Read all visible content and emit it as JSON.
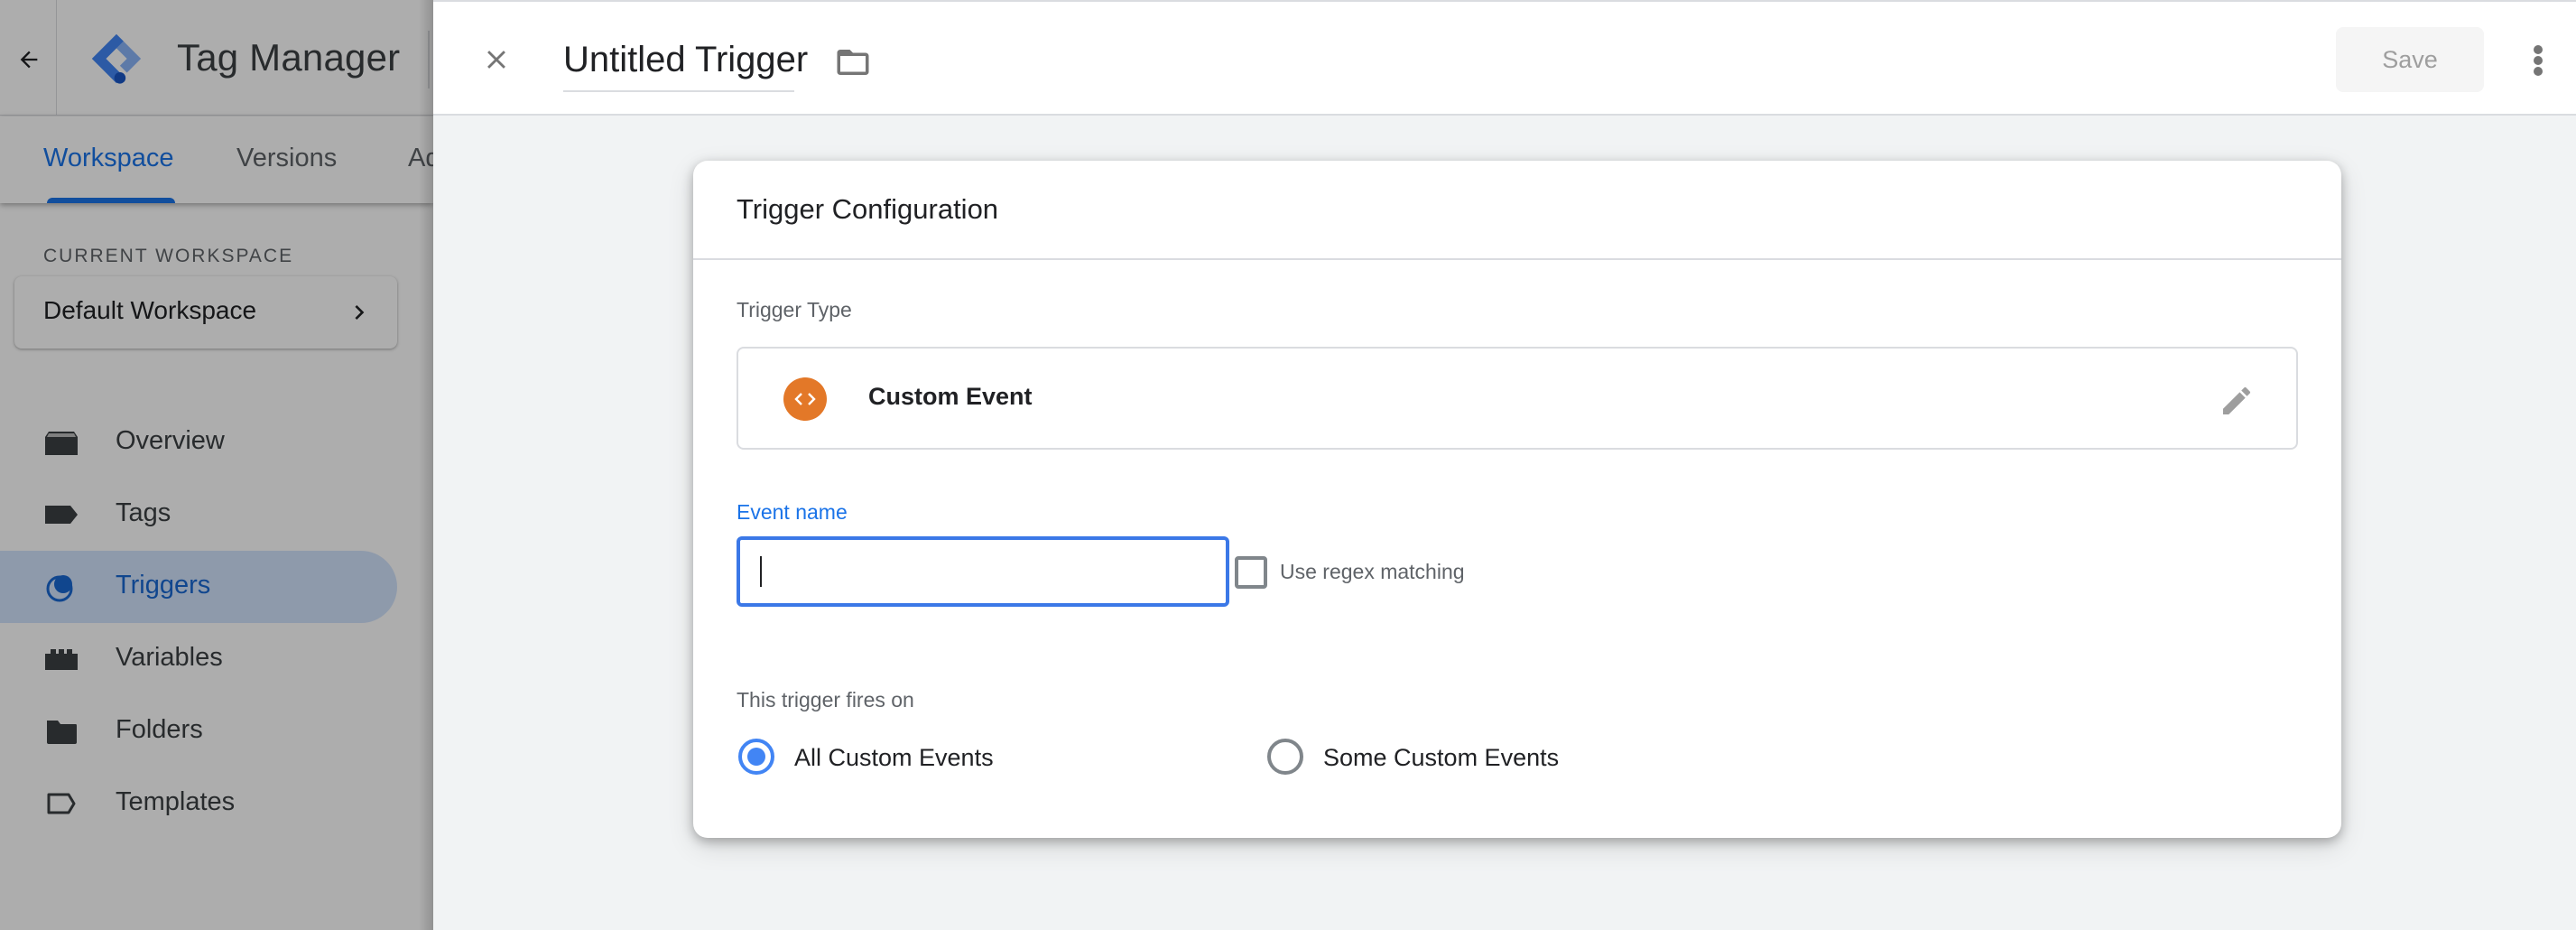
{
  "app": {
    "title": "Tag Manager",
    "brand_color": "#1a73e8",
    "back_icon": "arrow-left-icon",
    "logo_icon": "gtm-logo-icon",
    "tabs": [
      {
        "label": "Workspace",
        "active": true
      },
      {
        "label": "Versions",
        "active": false
      },
      {
        "label": "Admin",
        "active": false
      }
    ],
    "tab_admin_visible_text": "Ad",
    "workspace": {
      "section_label": "CURRENT WORKSPACE",
      "name": "Default Workspace",
      "chevron_icon": "chevron-right-icon"
    },
    "nav": [
      {
        "label": "Overview",
        "icon": "overview-icon",
        "active": false
      },
      {
        "label": "Tags",
        "icon": "tag-icon",
        "active": false
      },
      {
        "label": "Triggers",
        "icon": "trigger-icon",
        "active": true
      },
      {
        "label": "Variables",
        "icon": "variables-icon",
        "active": false
      },
      {
        "label": "Folders",
        "icon": "folder-icon",
        "active": false
      },
      {
        "label": "Templates",
        "icon": "template-icon",
        "active": false
      }
    ]
  },
  "editor": {
    "close_icon": "close-icon",
    "trigger_name": "Untitled Trigger",
    "folder_icon": "folder-outline-icon",
    "save_label": "Save",
    "save_enabled": false,
    "more_icon": "more-vert-icon",
    "card": {
      "title": "Trigger Configuration",
      "trigger_type_label": "Trigger Type",
      "trigger_type": {
        "name": "Custom Event",
        "icon": "code-brackets-icon",
        "icon_color": "#e37828",
        "edit_icon": "pencil-icon"
      },
      "event_name": {
        "label": "Event name",
        "value": "",
        "placeholder": "",
        "focused": true
      },
      "regex": {
        "label": "Use regex matching",
        "checked": false
      },
      "fires_on": {
        "label": "This trigger fires on",
        "options": [
          {
            "label": "All Custom Events",
            "selected": true
          },
          {
            "label": "Some Custom Events",
            "selected": false
          }
        ]
      }
    }
  }
}
